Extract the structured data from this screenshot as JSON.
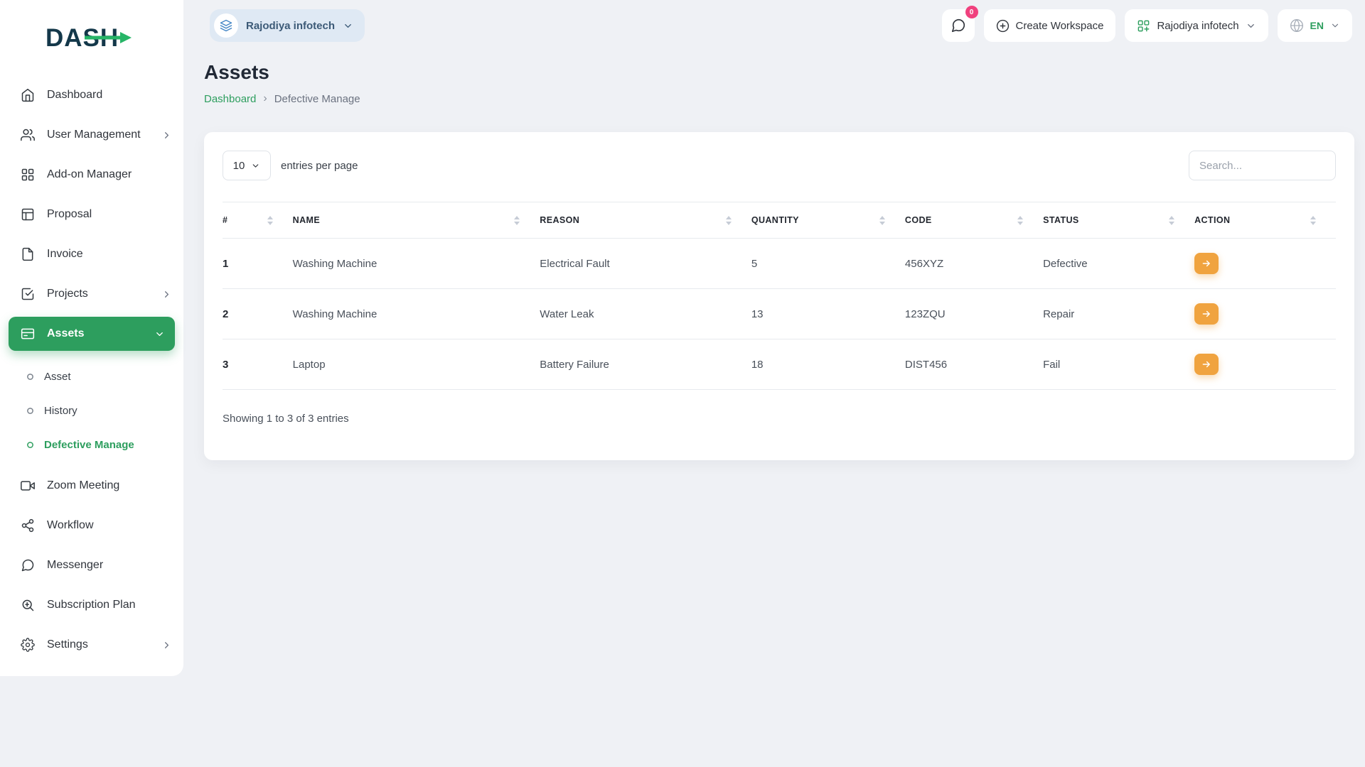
{
  "colors": {
    "accent_green": "#2d9e5e",
    "action_orange": "#f0a33f",
    "badge_pink": "#f0417e",
    "workspace_icon_blue": "#4788c7",
    "logo_navy": "#14384a"
  },
  "brand": {
    "logo_text": "DASH"
  },
  "topbar": {
    "workspace_pill_label": "Rajodiya infotech",
    "messages_badge": "0",
    "create_workspace_label": "Create Workspace",
    "company_dropdown_label": "Rajodiya infotech",
    "language_label": "EN"
  },
  "sidebar": {
    "items": [
      {
        "label": "Dashboard"
      },
      {
        "label": "User Management",
        "has_children": true
      },
      {
        "label": "Add-on Manager"
      },
      {
        "label": "Proposal"
      },
      {
        "label": "Invoice"
      },
      {
        "label": "Projects",
        "has_children": true
      },
      {
        "label": "Assets",
        "active": true,
        "expanded": true
      },
      {
        "label": "Zoom Meeting"
      },
      {
        "label": "Workflow"
      },
      {
        "label": "Messenger"
      },
      {
        "label": "Subscription Plan"
      },
      {
        "label": "Settings",
        "has_children": true
      }
    ],
    "assets_submenu": [
      {
        "label": "Asset"
      },
      {
        "label": "History"
      },
      {
        "label": "Defective Manage",
        "active": true
      }
    ]
  },
  "page": {
    "title": "Assets",
    "breadcrumb": {
      "root": "Dashboard",
      "current": "Defective Manage"
    }
  },
  "table": {
    "entries_per_page_value": "10",
    "entries_per_page_label": "entries per page",
    "search_placeholder": "Search...",
    "columns": [
      {
        "label": "#"
      },
      {
        "label": "NAME"
      },
      {
        "label": "REASON"
      },
      {
        "label": "QUANTITY"
      },
      {
        "label": "CODE"
      },
      {
        "label": "STATUS"
      },
      {
        "label": "ACTION"
      }
    ],
    "rows": [
      {
        "num": "1",
        "name": "Washing Machine",
        "reason": "Electrical Fault",
        "quantity": "5",
        "code": "456XYZ",
        "status": "Defective"
      },
      {
        "num": "2",
        "name": "Washing Machine",
        "reason": "Water Leak",
        "quantity": "13",
        "code": "123ZQU",
        "status": "Repair"
      },
      {
        "num": "3",
        "name": "Laptop",
        "reason": "Battery Failure",
        "quantity": "18",
        "code": "DIST456",
        "status": "Fail"
      }
    ],
    "summary": "Showing 1 to 3 of 3 entries"
  }
}
